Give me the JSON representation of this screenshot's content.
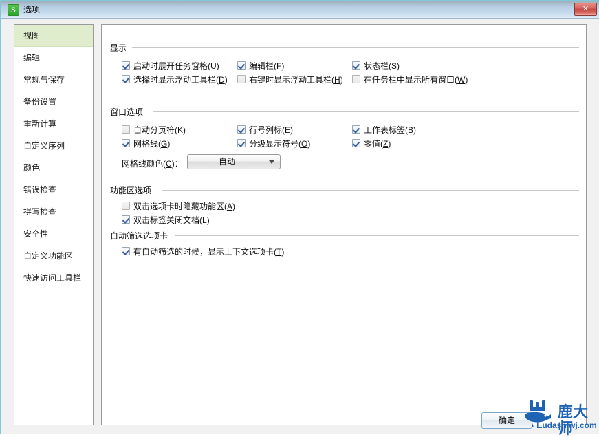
{
  "window": {
    "title": "选项",
    "app_icon": "wps-spreadsheet-icon",
    "icon_letter": "S",
    "close_label": "✕",
    "accent_border": "#7ec8d8",
    "titlebar_gradient_top": "#9fb0bb",
    "titlebar_gradient_bottom": "#e4eef7"
  },
  "sidebar": {
    "selected_index": 0,
    "selected_bg": "#dfedcd",
    "items": [
      {
        "label": "视图"
      },
      {
        "label": "编辑"
      },
      {
        "label": "常规与保存"
      },
      {
        "label": "备份设置"
      },
      {
        "label": "重新计算"
      },
      {
        "label": "自定义序列"
      },
      {
        "label": "颜色"
      },
      {
        "label": "错误检查"
      },
      {
        "label": "拼写检查"
      },
      {
        "label": "安全性"
      },
      {
        "label": "自定义功能区"
      },
      {
        "label": "快速访问工具栏"
      }
    ]
  },
  "groups": {
    "display": {
      "title": "显示",
      "checkboxes": [
        {
          "label": "启动时展开任务窗格",
          "accel": "U",
          "checked": true
        },
        {
          "label": "编辑栏",
          "accel": "F",
          "checked": true
        },
        {
          "label": "状态栏",
          "accel": "S",
          "checked": true
        },
        {
          "label": "选择时显示浮动工具栏",
          "accel": "D",
          "checked": true
        },
        {
          "label": "右键时显示浮动工具栏",
          "accel": "H",
          "checked": false
        },
        {
          "label": "在任务栏中显示所有窗口",
          "accel": "W",
          "checked": false
        }
      ]
    },
    "window_options": {
      "title": "窗口选项",
      "checkboxes": [
        {
          "label": "自动分页符",
          "accel": "K",
          "checked": false
        },
        {
          "label": "行号列标",
          "accel": "E",
          "checked": true
        },
        {
          "label": "工作表标签",
          "accel": "B",
          "checked": true
        },
        {
          "label": "网格线",
          "accel": "G",
          "checked": true
        },
        {
          "label": "分级显示符号",
          "accel": "O",
          "checked": true
        },
        {
          "label": "零值",
          "accel": "Z",
          "checked": true
        }
      ],
      "gridline_color": {
        "label": "网格线颜色",
        "accel": "C",
        "suffix": "：",
        "value": "自动"
      }
    },
    "ribbon_options": {
      "title": "功能区选项",
      "checkboxes": [
        {
          "label": "双击选项卡时隐藏功能区",
          "accel": "A",
          "checked": false
        },
        {
          "label": "双击标签关闭文档",
          "accel": "L",
          "checked": true
        }
      ]
    },
    "autofilter_tab": {
      "title": "自动筛选选项卡",
      "checkboxes": [
        {
          "label": "有自动筛选的时候，显示上下文选项卡",
          "accel": "T",
          "checked": true
        }
      ]
    }
  },
  "footer": {
    "ok_label": "确定"
  },
  "watermark": {
    "brand": "鹿大师",
    "domain": "Ludashiwj.com",
    "color": "#1f63b5"
  }
}
